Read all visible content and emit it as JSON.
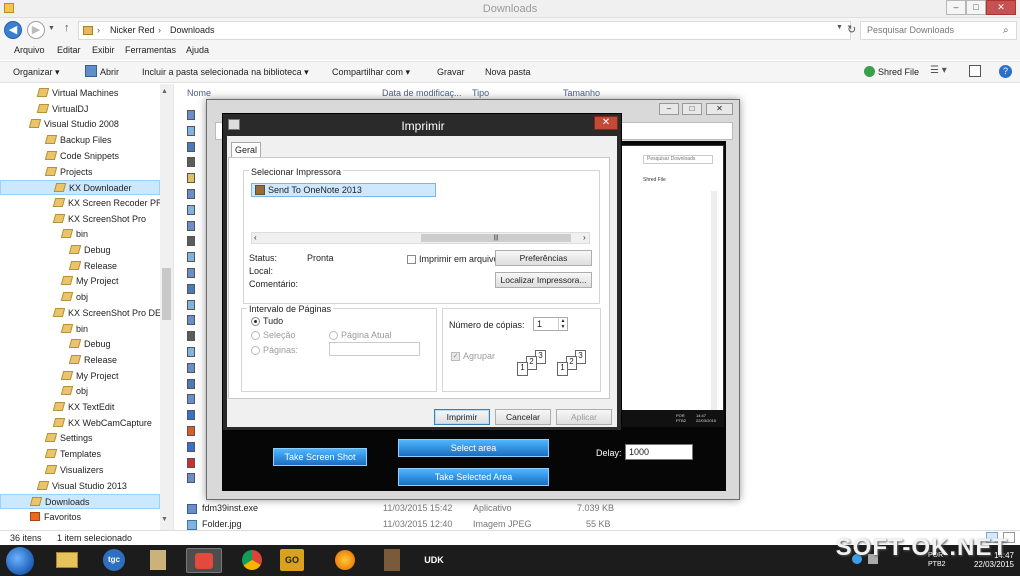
{
  "window": {
    "title": "Downloads",
    "minimize": "–",
    "maximize": "□",
    "close": "✕"
  },
  "address": {
    "path": [
      "Nicker Red",
      "Downloads"
    ],
    "search_placeholder": "Pesquisar Downloads"
  },
  "menu": [
    "Arquivo",
    "Editar",
    "Exibir",
    "Ferramentas",
    "Ajuda"
  ],
  "commands": {
    "organize": "Organizar ▾",
    "open": "Abrir",
    "include": "Incluir a pasta selecionada na biblioteca ▾",
    "share": "Compartilhar com ▾",
    "burn": "Gravar",
    "new_folder": "Nova pasta",
    "shred": "Shred File"
  },
  "nav_tree": [
    {
      "label": "Virtual Machines",
      "selected": false
    },
    {
      "label": "VirtualDJ",
      "selected": false
    },
    {
      "label": "Visual Studio 2008",
      "selected": false
    },
    {
      "label": "Backup Files",
      "selected": false
    },
    {
      "label": "Code Snippets",
      "selected": false
    },
    {
      "label": "Projects",
      "selected": false
    },
    {
      "label": "KX Downloader",
      "selected": true
    },
    {
      "label": "KX Screen Recoder PRO",
      "selected": false
    },
    {
      "label": "KX ScreenShot Pro",
      "selected": false
    },
    {
      "label": "bin",
      "selected": false
    },
    {
      "label": "Debug",
      "selected": false
    },
    {
      "label": "Release",
      "selected": false
    },
    {
      "label": "My Project",
      "selected": false
    },
    {
      "label": "obj",
      "selected": false
    },
    {
      "label": "KX ScreenShot Pro DEM",
      "selected": false
    },
    {
      "label": "bin",
      "selected": false
    },
    {
      "label": "Debug",
      "selected": false
    },
    {
      "label": "Release",
      "selected": false
    },
    {
      "label": "My Project",
      "selected": false
    },
    {
      "label": "obj",
      "selected": false
    },
    {
      "label": "KX TextEdit",
      "selected": false
    },
    {
      "label": "KX WebCamCapture",
      "selected": false
    },
    {
      "label": "Settings",
      "selected": false
    },
    {
      "label": "Templates",
      "selected": false
    },
    {
      "label": "Visualizers",
      "selected": false
    },
    {
      "label": "Visual Studio 2013",
      "selected": false
    },
    {
      "label": "Downloads",
      "selected": true
    },
    {
      "label": "Favoritos",
      "selected": false
    }
  ],
  "columns": {
    "name": "Nome",
    "date": "Data de modificaç...",
    "type": "Tipo",
    "size": "Tamanho"
  },
  "files": [
    {
      "name": "fdm39inst.exe",
      "date": "11/03/2015 15:42",
      "type": "Aplicativo",
      "size": "7.039 KB"
    },
    {
      "name": "Folder.jpg",
      "date": "11/03/2015 12:40",
      "type": "Imagem JPEG",
      "size": "55 KB"
    }
  ],
  "status": {
    "count": "36 itens",
    "selected": "1 item selecionado"
  },
  "app": {
    "take_screen_shot": "Take Screen Shot",
    "select_area": "Select area",
    "take_selected_area": "Take Selected Area",
    "delay_label": "Delay:",
    "delay_value": "1000",
    "inner_search": "Pesquisar Downloads",
    "inner_shred": "Shred File"
  },
  "print_dialog": {
    "title": "Imprimir",
    "tab": "Geral",
    "select_printer_label": "Selecionar Impressora",
    "printer": "Send To OneNote 2013",
    "status_label": "Status:",
    "status_value": "Pronta",
    "location_label": "Local:",
    "comment_label": "Comentário:",
    "print_to_file": "Imprimir em arquivo",
    "preferences": "Preferências",
    "find_printer": "Localizar Impressora...",
    "page_range_label": "Intervalo de Páginas",
    "all": "Tudo",
    "selection": "Seleção",
    "current_page": "Página Atual",
    "pages": "Páginas:",
    "copies_label": "Número de cópias:",
    "copies_value": "1",
    "collate": "Agrupar",
    "print": "Imprimir",
    "cancel": "Cancelar",
    "apply": "Aplicar"
  },
  "taskbar": {
    "items": [
      "",
      "",
      "tgc",
      "",
      "",
      "",
      "GO",
      "",
      "",
      "UDK"
    ],
    "clock_time": "14:47",
    "clock_date": "22/03/2015",
    "lang_top": "POR",
    "lang_bottom": "PTB2"
  },
  "watermark": "SOFT-OK.NET"
}
